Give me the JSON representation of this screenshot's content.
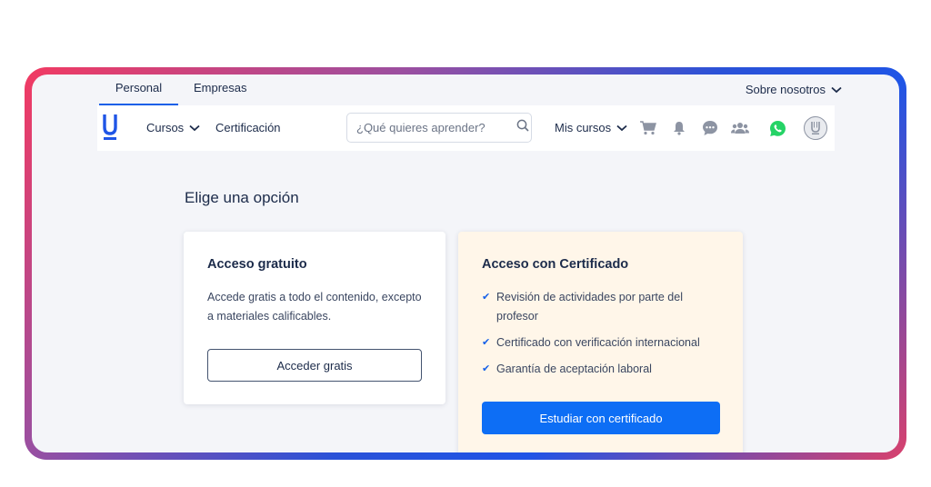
{
  "top_tabs": {
    "personal": "Personal",
    "empresas": "Empresas",
    "about": "Sobre nosotros"
  },
  "navbar": {
    "logo": "U",
    "cursos": "Cursos",
    "certificacion": "Certificación",
    "search_placeholder": "¿Qué quieres aprender?",
    "mis_cursos": "Mis cursos",
    "icons": [
      "cart-icon",
      "bell-icon",
      "chat-icon",
      "users-icon",
      "whatsapp-icon",
      "avatar"
    ]
  },
  "main": {
    "heading": "Elige una opción",
    "free_card": {
      "title": "Acceso gratuito",
      "description": "Accede gratis a todo el contenido, excepto a materiales calificables.",
      "button": "Acceder gratis"
    },
    "cert_card": {
      "title": "Acceso con Certificado",
      "benefits": [
        "Revisión de actividades por parte del profesor",
        "Certificado con verificación internacional",
        "Garantía de aceptación laboral"
      ],
      "button": "Estudiar con certificado"
    }
  },
  "colors": {
    "accent": "#0d6ef5",
    "text": "#1c2b4a",
    "cert_bg": "#fff6e9",
    "whatsapp": "#25d366"
  }
}
